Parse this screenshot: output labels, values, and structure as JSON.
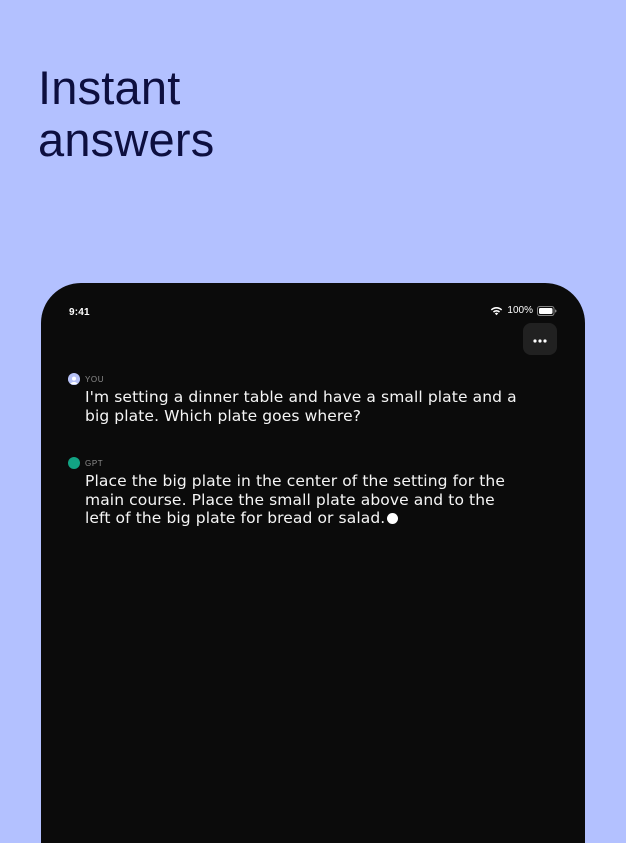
{
  "headline": {
    "line1": "Instant",
    "line2": "answers"
  },
  "status_bar": {
    "time": "9:41",
    "battery": "100%",
    "wifi_icon": "wifi-icon",
    "battery_icon": "battery-icon"
  },
  "toolbar": {
    "menu_icon": "more-horizontal-icon"
  },
  "conversation": [
    {
      "sender": "YOU",
      "avatar_color": "#b7c2f7",
      "text": "I'm setting a dinner table and have a small plate and a big plate. Which plate goes where?"
    },
    {
      "sender": "GPT",
      "avatar_color": "#12a383",
      "text": "Place the big plate in the center of the setting for the main course. Place the small plate above and to the left of the big plate for bread or salad."
    }
  ],
  "colors": {
    "background": "#b3c1ff",
    "headline": "#0d0f3f",
    "device": "#0b0b0b",
    "text": "#f5f5f5"
  }
}
